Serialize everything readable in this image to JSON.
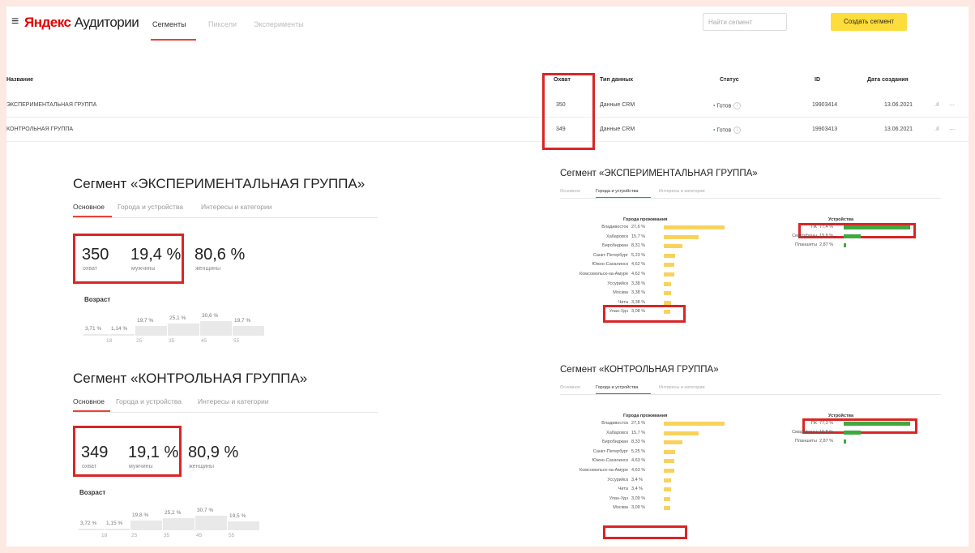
{
  "header": {
    "menu_icon": "hamburger-icon",
    "logo_brand": "Яндекс",
    "logo_product": "Аудитории",
    "tabs": [
      "Сегменты",
      "Пиксели",
      "Эксперименты"
    ],
    "search_placeholder": "Найти сегмент",
    "create_button": "Создать сегмент"
  },
  "table": {
    "columns": [
      "Название",
      "Охват",
      "Тип данных",
      "Статус",
      "ID",
      "Дата создания"
    ],
    "rows": [
      {
        "name": "ЭКСПЕРИМЕНТАЛЬНАЯ ГРУППА",
        "reach": "350",
        "type": "Данные CRM",
        "status": "Готов",
        "id": "19903414",
        "date": "13.06.2021"
      },
      {
        "name": "КОНТРОЛЬНАЯ ГРУППА",
        "reach": "349",
        "type": "Данные CRM",
        "status": "Готов",
        "id": "19903413",
        "date": "13.06.2021"
      }
    ],
    "row_icons": [
      "chart-icon",
      "more-icon"
    ]
  },
  "colors": {
    "accent_yellow": "#fddd3b",
    "tab_underline": "#e8433a",
    "highlight": "#d92626",
    "city_bar": "#f7d35e",
    "device_bar": "#3fa83f"
  },
  "seg1": {
    "title": "Сегмент «ЭКСПЕРИМЕНТАЛЬНАЯ ГРУППА»",
    "tabs": [
      "Основное",
      "Города и устройства",
      "Интересы и категории"
    ],
    "reach": "350",
    "reach_label": "охват",
    "male": "19,4 %",
    "male_label": "мужчины",
    "female": "80,6 %",
    "female_label": "женщины",
    "age_heading": "Возраст",
    "age_pcts": [
      "3,71 %",
      "1,14 %",
      "19,7 %",
      "25,1 %",
      "30,6 %",
      "19,7 %"
    ],
    "age_ticks": [
      "18",
      "25",
      "35",
      "45",
      "55"
    ]
  },
  "seg2": {
    "title": "Сегмент «КОНТРОЛЬНАЯ ГРУППА»",
    "tabs": [
      "Основное",
      "Города и устройства",
      "Интересы и категории"
    ],
    "reach": "349",
    "reach_label": "охват",
    "male": "19,1 %",
    "male_label": "мужчины",
    "female": "80,9 %",
    "female_label": "женщины",
    "age_heading": "Возраст",
    "age_pcts": [
      "3,72 %",
      "1,15 %",
      "19,8 %",
      "25,2 %",
      "30,7 %",
      "19,5 %"
    ],
    "age_ticks": [
      "18",
      "25",
      "35",
      "45",
      "55"
    ]
  },
  "rseg1": {
    "title": "Сегмент «ЭКСПЕРИМЕНТАЛЬНАЯ ГРУППА»",
    "tabs": [
      "Основное",
      "Города и устройства",
      "Интересы и категории"
    ],
    "cities_caption": "Города проживания",
    "devices_caption": "Устройства",
    "cities": [
      {
        "name": "Владивосток",
        "pct": "27,6 %",
        "val": 27.6
      },
      {
        "name": "Хабаровск",
        "pct": "15,7 %",
        "val": 15.7
      },
      {
        "name": "Биробиджан",
        "pct": "8,31 %",
        "val": 8.31
      },
      {
        "name": "Санкт-Петербург",
        "pct": "5,23 %",
        "val": 5.23
      },
      {
        "name": "Южно-Сахалинск",
        "pct": "4,62 %",
        "val": 4.62
      },
      {
        "name": "Комсомольск-на-Амуре",
        "pct": "4,62 %",
        "val": 4.62
      },
      {
        "name": "Уссурийск",
        "pct": "3,38 %",
        "val": 3.38
      },
      {
        "name": "Москва",
        "pct": "3,38 %",
        "val": 3.38
      },
      {
        "name": "Чита",
        "pct": "3,38 %",
        "val": 3.38
      },
      {
        "name": "Улан-Удэ",
        "pct": "3,08 %",
        "val": 3.08
      }
    ],
    "devices": [
      {
        "name": "ПК",
        "pct": "77,4 %",
        "val": 77.4
      },
      {
        "name": "Смартфоны",
        "pct": "19,8 %",
        "val": 19.8
      },
      {
        "name": "Планшеты",
        "pct": "2,87 %",
        "val": 2.87
      }
    ]
  },
  "rseg2": {
    "title": "Сегмент «КОНТРОЛЬНАЯ ГРУППА»",
    "tabs": [
      "Основное",
      "Города и устройства",
      "Интересы и категории"
    ],
    "cities_caption": "Города проживания",
    "devices_caption": "Устройства",
    "cities": [
      {
        "name": "Владивосток",
        "pct": "27,5 %",
        "val": 27.5
      },
      {
        "name": "Хабаровск",
        "pct": "15,7 %",
        "val": 15.7
      },
      {
        "name": "Биробиджан",
        "pct": "8,33 %",
        "val": 8.33
      },
      {
        "name": "Санкт-Петербург",
        "pct": "5,25 %",
        "val": 5.25
      },
      {
        "name": "Южно-Сахалинск",
        "pct": "4,63 %",
        "val": 4.63
      },
      {
        "name": "Комсомольск-на-Амуре",
        "pct": "4,63 %",
        "val": 4.63
      },
      {
        "name": "Уссурийск",
        "pct": "3,4 %",
        "val": 3.4
      },
      {
        "name": "Чита",
        "pct": "3,4 %",
        "val": 3.4
      },
      {
        "name": "Улан-Удэ",
        "pct": "3,09 %",
        "val": 3.09
      },
      {
        "name": "Москва",
        "pct": "3,09 %",
        "val": 3.09
      }
    ],
    "devices": [
      {
        "name": "ПК",
        "pct": "77,3 %",
        "val": 77.3
      },
      {
        "name": "Смартфоны",
        "pct": "19,8 %",
        "val": 19.8
      },
      {
        "name": "Планшеты",
        "pct": "2,87 %",
        "val": 2.87
      }
    ]
  }
}
